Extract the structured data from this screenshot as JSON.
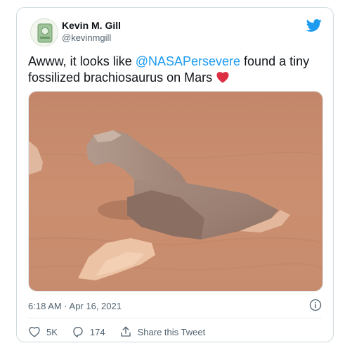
{
  "user": {
    "name": "Kevin M. Gill",
    "handle": "@kevinmgill"
  },
  "tweet": {
    "text_before": "Awww, it looks like ",
    "mention": "@NASAPersevere",
    "text_after": " found a tiny fossilized brachiosaurus on Mars ",
    "emoji": "red-heart"
  },
  "media": {
    "alt": ""
  },
  "meta": {
    "timestamp": "6:18 AM · Apr 16, 2021"
  },
  "actions": {
    "like_count": "5K",
    "reply_count": "174",
    "share_label": "Share this Tweet"
  },
  "colors": {
    "accent": "#1d9bf0",
    "muted": "#536471",
    "heart": "#e0245e",
    "mars_sand": "#c88a6a"
  },
  "icons": [
    "twitter-bird-icon",
    "info-icon",
    "heart-icon",
    "reply-icon",
    "share-icon"
  ]
}
